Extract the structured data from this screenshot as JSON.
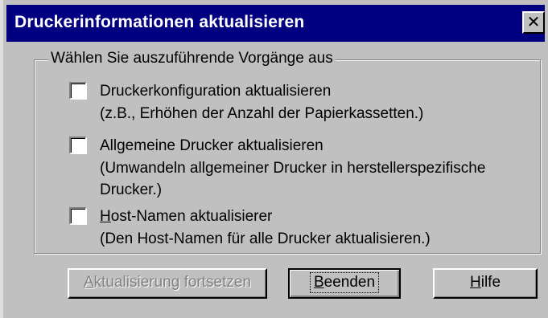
{
  "dialog": {
    "title": "Druckerinformationen aktualisieren",
    "close_glyph": "✕"
  },
  "group": {
    "legend": "Wählen Sie auszuführende Vorgänge aus"
  },
  "options": [
    {
      "label": "Druckerkonfiguration aktualisieren",
      "description": "(z.B., Erhöhen der Anzahl der Papierkassetten.)",
      "checked": false
    },
    {
      "label": "Allgemeine Drucker aktualisieren",
      "description": "(Umwandeln allgemeiner Drucker in herstellerspezifische Drucker.)",
      "checked": false
    },
    {
      "label_mnemonic": "H",
      "label_rest": "ost-Namen aktualisierer",
      "description": "(Den Host-Namen für alle Drucker aktualisieren.)",
      "checked": false
    }
  ],
  "buttons": {
    "continue_mnemonic": "A",
    "continue_rest": "ktualisierung fortsetzen",
    "continue_enabled": false,
    "exit_mnemonic": "B",
    "exit_rest": "eenden",
    "help_mnemonic": "H",
    "help_rest": "ilfe"
  },
  "colors": {
    "title_bar": "#000080",
    "dialog_face": "#c0c0c0",
    "disabled_text": "#808080"
  }
}
